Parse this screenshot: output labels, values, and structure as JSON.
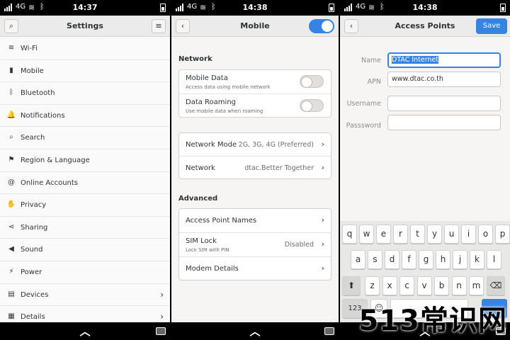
{
  "panels": {
    "settings": {
      "status": {
        "network": "4G",
        "time": "14:37"
      },
      "title": "Settings",
      "items": [
        {
          "label": "Wi-Fi",
          "icon": "wifi-icon",
          "glyph": "≋"
        },
        {
          "label": "Mobile",
          "icon": "signal-bars-icon",
          "glyph": "▮"
        },
        {
          "label": "Bluetooth",
          "icon": "bluetooth-icon",
          "glyph": "ᛒ"
        },
        {
          "label": "Notifications",
          "icon": "bell-icon",
          "glyph": "🔔"
        },
        {
          "label": "Search",
          "icon": "search-icon",
          "glyph": "⌕"
        },
        {
          "label": "Region & Language",
          "icon": "flag-icon",
          "glyph": "⚑"
        },
        {
          "label": "Online Accounts",
          "icon": "at-sign-icon",
          "glyph": "@"
        },
        {
          "label": "Privacy",
          "icon": "hand-icon",
          "glyph": "✋"
        },
        {
          "label": "Sharing",
          "icon": "share-icon",
          "glyph": "⋖"
        },
        {
          "label": "Sound",
          "icon": "speaker-icon",
          "glyph": "◀"
        },
        {
          "label": "Power",
          "icon": "power-icon",
          "glyph": "⚡"
        },
        {
          "label": "Devices",
          "icon": "devices-icon",
          "glyph": "▤",
          "arrow": true
        },
        {
          "label": "Details",
          "icon": "details-icon",
          "glyph": "▦",
          "arrow": true
        }
      ]
    },
    "mobile": {
      "status": {
        "network": "4G",
        "time": "14:38"
      },
      "title": "Mobile",
      "network_section": "Network",
      "mobile_data": {
        "title": "Mobile Data",
        "subtitle": "Access data using mobile network"
      },
      "data_roaming": {
        "title": "Data Roaming",
        "subtitle": "Use mobile data when roaming"
      },
      "network_mode": {
        "title": "Network Mode",
        "value": "2G, 3G, 4G (Preferred)"
      },
      "network": {
        "title": "Network",
        "value": "dtac.Better Together"
      },
      "advanced_section": "Advanced",
      "apn": {
        "title": "Access Point Names"
      },
      "sim_lock": {
        "title": "SIM Lock",
        "subtitle": "Lock SIM with PIN",
        "value": "Disabled"
      },
      "modem": {
        "title": "Modem Details"
      }
    },
    "apn": {
      "status": {
        "network": "4G",
        "time": "14:38"
      },
      "title": "Access Points",
      "save_label": "Save",
      "fields": {
        "name": {
          "label": "Name",
          "value": "DTAC Internet"
        },
        "apn": {
          "label": "APN",
          "value": "www.dtac.co.th"
        },
        "username": {
          "label": "Username",
          "value": ""
        },
        "password": {
          "label": "Passsword",
          "value": ""
        }
      },
      "keyboard": {
        "row1": [
          "q",
          "w",
          "e",
          "r",
          "t",
          "y",
          "u",
          "i",
          "o",
          "p"
        ],
        "row2": [
          "a",
          "s",
          "d",
          "f",
          "g",
          "h",
          "j",
          "k",
          "l"
        ],
        "row3": [
          "z",
          "x",
          "c",
          "v",
          "b",
          "n",
          "m"
        ],
        "numbers_label": "123"
      }
    }
  },
  "overlay_watermark": "513常识网",
  "colors": {
    "accent": "#3584e4",
    "background": "#f6f5f4",
    "header": "#ebebeb"
  }
}
